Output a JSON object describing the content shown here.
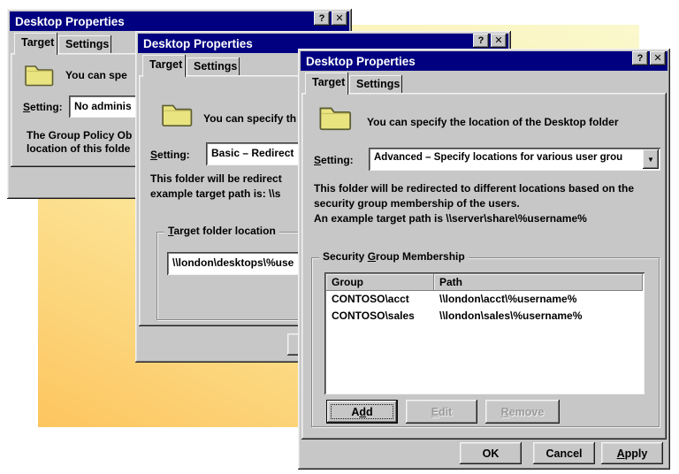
{
  "accent_panel": {
    "gradient_from": "#faf8cd",
    "gradient_to": "#fdc55f"
  },
  "colors": {
    "titlebar": "#000080",
    "titlebar_text": "#ffffff",
    "dialog_face": "#c7c7c7",
    "disabled_text": "#9b9b9b",
    "folder_fill": "#e9e47f"
  },
  "windows": [
    {
      "title": "Desktop Properties",
      "help_glyph": "?",
      "close_glyph": "✕",
      "tabs": [
        "Target",
        "Settings"
      ],
      "intro": "You can spe",
      "setting_label": {
        "u": "S",
        "post": "etting:"
      },
      "setting_value": "No adminis",
      "body_lines": [
        "The Group Policy Ob",
        "location of this folde"
      ]
    },
    {
      "title": "Desktop Properties",
      "help_glyph": "?",
      "close_glyph": "✕",
      "tabs": [
        "Target",
        "Settings"
      ],
      "intro": "You can specify th",
      "setting_label": {
        "u": "S",
        "post": "etting:"
      },
      "setting_value": "Basic – Redirect",
      "body_lines": [
        "This folder will be redirect",
        "example target path is: \\\\s"
      ],
      "group_label": {
        "u": "T",
        "post": "arget folder location"
      },
      "target_path": "\\\\london\\desktops\\%use"
    },
    {
      "title": "Desktop Properties",
      "help_glyph": "?",
      "close_glyph": "✕",
      "dropdown_glyph": "▼",
      "tabs": [
        "Target",
        "Settings"
      ],
      "intro": "You can specify the location of the Desktop folder",
      "setting_label": {
        "u": "S",
        "post": "etting:"
      },
      "setting_value": "Advanced – Specify locations for various user grou",
      "body_lines": [
        "This folder will be redirected to different locations based on the",
        "security group membership of the users.",
        "An example target path is \\\\server\\share\\%username%"
      ],
      "group_label": {
        "pre": "Security ",
        "u": "G",
        "post": "roup Membership"
      },
      "list": {
        "columns": [
          "Group",
          "Path"
        ],
        "rows": [
          {
            "group": "CONTOSO\\acct",
            "path": "\\\\london\\acct\\%username%"
          },
          {
            "group": "CONTOSO\\sales",
            "path": "\\\\london\\sales\\%username%"
          }
        ]
      },
      "buttons": {
        "add": {
          "pre": "A",
          "u": "d",
          "post": "d"
        },
        "edit": {
          "u": "E",
          "post": "dit"
        },
        "remove": {
          "u": "R",
          "post": "emove"
        },
        "ok": "OK",
        "cancel": "Cancel",
        "apply": {
          "u": "A",
          "post": "pply"
        }
      }
    }
  ]
}
